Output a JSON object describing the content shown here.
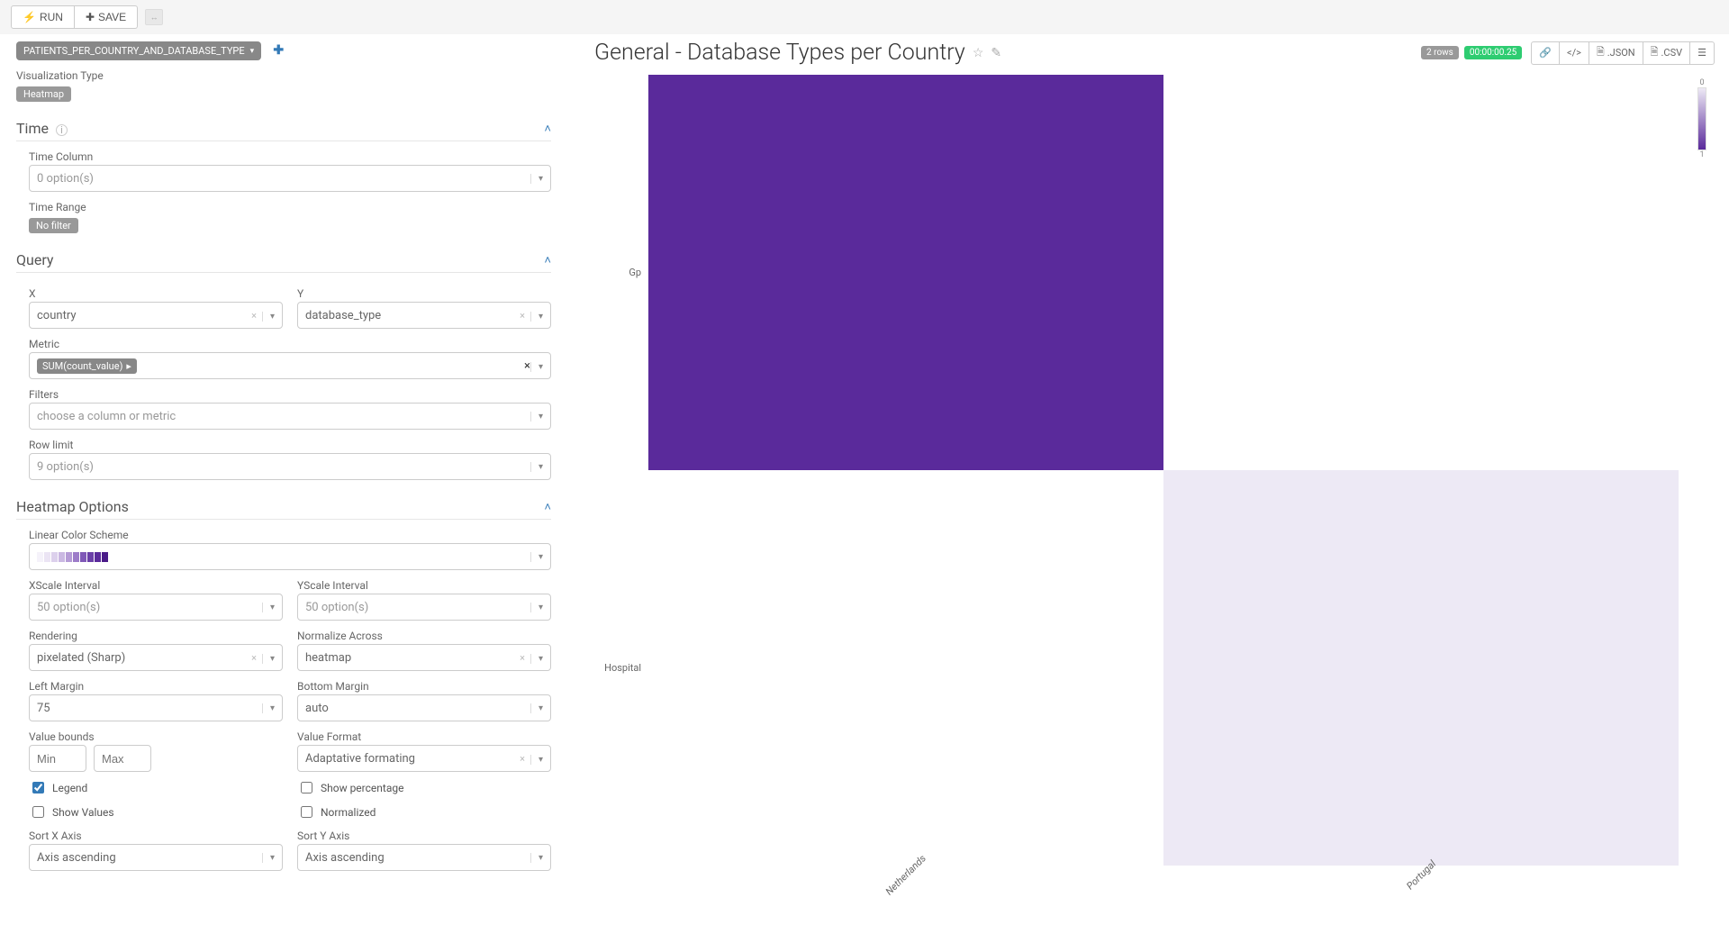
{
  "topbar": {
    "run": "RUN",
    "save": "SAVE"
  },
  "datasource": {
    "pill": "PATIENTS_PER_COUNTRY_AND_DATABASE_TYPE",
    "viz_label": "Visualization Type",
    "viz_value": "Heatmap"
  },
  "time": {
    "title": "Time",
    "column_label": "Time Column",
    "column_value": "0 option(s)",
    "range_label": "Time Range",
    "range_value": "No filter"
  },
  "query": {
    "title": "Query",
    "x_label": "X",
    "x_value": "country",
    "y_label": "Y",
    "y_value": "database_type",
    "metric_label": "Metric",
    "metric_value": "SUM(count_value)",
    "filters_label": "Filters",
    "filters_placeholder": "choose a column or metric",
    "rowlimit_label": "Row limit",
    "rowlimit_value": "9 option(s)"
  },
  "heatmap": {
    "title": "Heatmap Options",
    "colorscheme_label": "Linear Color Scheme",
    "xscale_label": "XScale Interval",
    "xscale_value": "50 option(s)",
    "yscale_label": "YScale Interval",
    "yscale_value": "50 option(s)",
    "rendering_label": "Rendering",
    "rendering_value": "pixelated (Sharp)",
    "normalize_label": "Normalize Across",
    "normalize_value": "heatmap",
    "leftmargin_label": "Left Margin",
    "leftmargin_value": "75",
    "bottommargin_label": "Bottom Margin",
    "bottommargin_value": "auto",
    "valuebounds_label": "Value bounds",
    "min_placeholder": "Min",
    "max_placeholder": "Max",
    "valueformat_label": "Value Format",
    "valueformat_value": "Adaptative formating",
    "legend_label": "Legend",
    "showpct_label": "Show percentage",
    "showvals_label": "Show Values",
    "normalized_label": "Normalized",
    "sortx_label": "Sort X Axis",
    "sortx_value": "Axis ascending",
    "sorty_label": "Sort Y Axis",
    "sorty_value": "Axis ascending"
  },
  "chart": {
    "title": "General - Database Types per Country",
    "rows_badge": "2 rows",
    "time_badge": "00:00:00.25",
    "json_btn": ".JSON",
    "csv_btn": ".CSV"
  },
  "chart_data": {
    "type": "heatmap",
    "x_categories": [
      "Netherlands",
      "Portugal"
    ],
    "y_categories": [
      "Gp",
      "Hospital"
    ],
    "values": [
      [
        1,
        null
      ],
      [
        null,
        0
      ]
    ],
    "color_scale": {
      "domain": [
        0,
        1
      ],
      "colors": [
        "#ede9f5",
        "#5a2a9b"
      ]
    },
    "legend": {
      "min": 0,
      "max": 1
    }
  },
  "color_swatches": [
    "#f5f2fa",
    "#ebe4f4",
    "#dcd0ec",
    "#cab8e2",
    "#b59bd6",
    "#9d7cc9",
    "#7f58b7",
    "#6a3fa8",
    "#5a2a9b",
    "#4a1b88"
  ]
}
